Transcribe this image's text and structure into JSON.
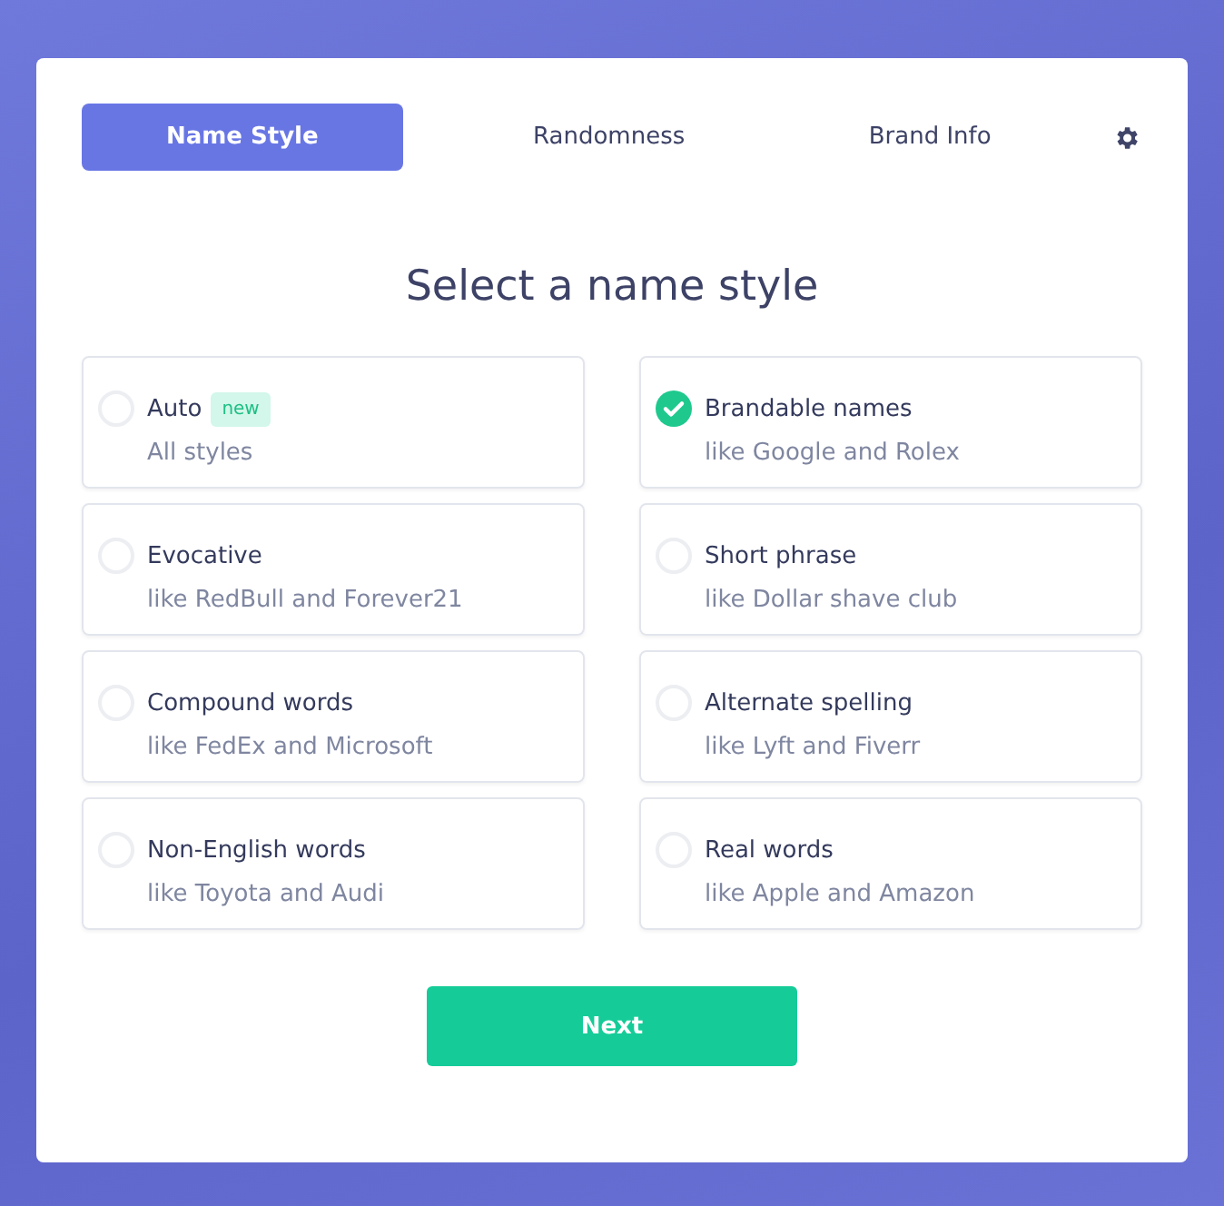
{
  "tabs": [
    {
      "label": "Name Style",
      "selected": true
    },
    {
      "label": "Randomness",
      "selected": false
    },
    {
      "label": "Brand Info",
      "selected": false
    }
  ],
  "heading": "Select a name style",
  "options": [
    {
      "name": "Auto",
      "badge": "new",
      "description": "All styles",
      "selected": false
    },
    {
      "name": "Brandable names",
      "description": "like Google and Rolex",
      "selected": true
    },
    {
      "name": "Evocative",
      "description": "like RedBull and Forever21",
      "selected": false
    },
    {
      "name": "Short phrase",
      "description": "like Dollar shave club",
      "selected": false
    },
    {
      "name": "Compound words",
      "description": "like FedEx and Microsoft",
      "selected": false
    },
    {
      "name": "Alternate spelling",
      "description": "like Lyft and Fiverr",
      "selected": false
    },
    {
      "name": "Non-English words",
      "description": "like Toyota and Audi",
      "selected": false
    },
    {
      "name": "Real words",
      "description": "like Apple and Amazon",
      "selected": false
    }
  ],
  "next_button": "Next"
}
